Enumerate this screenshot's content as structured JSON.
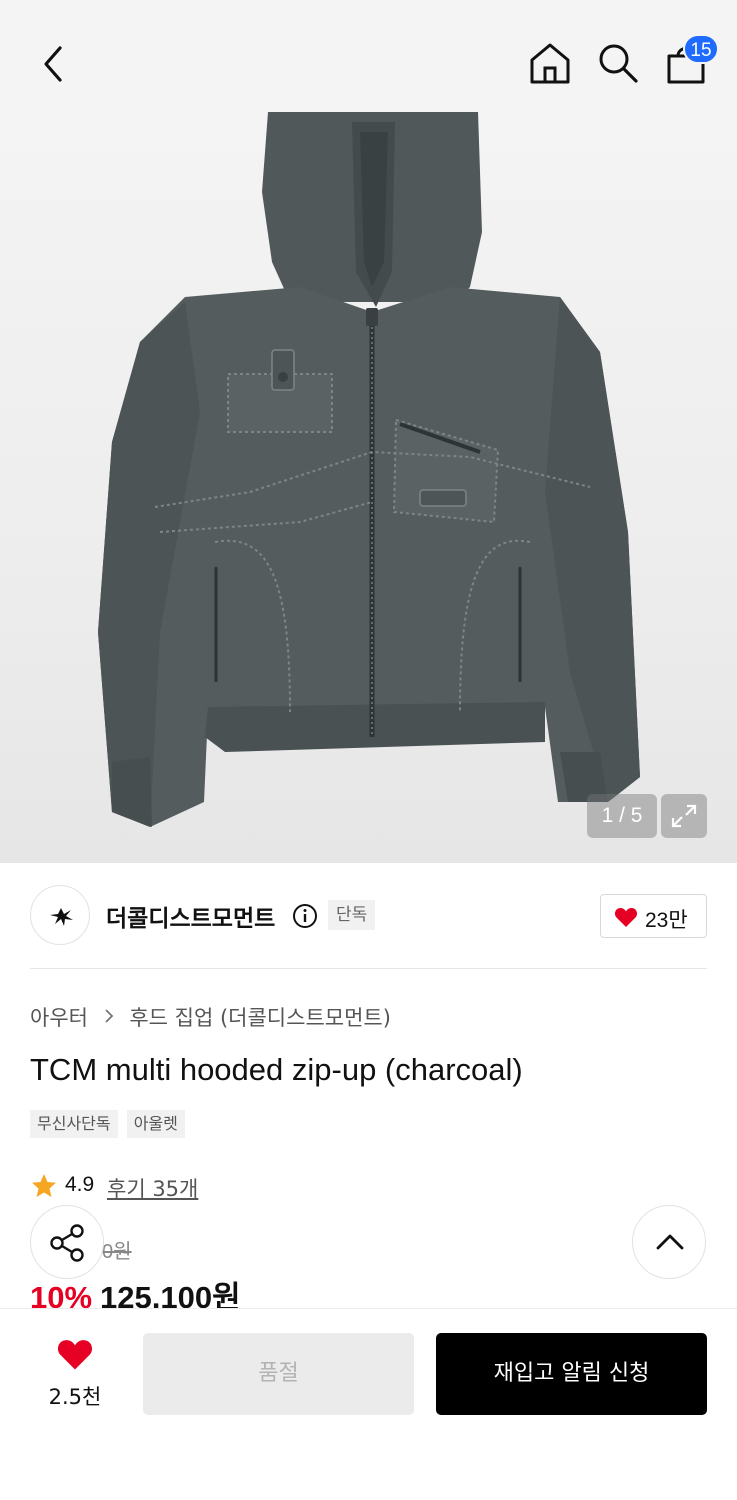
{
  "header": {
    "cart_count": "15"
  },
  "gallery": {
    "counter": "1 / 5"
  },
  "brand": {
    "name": "더콜디스트모먼트",
    "exclusive_tag": "단독",
    "likes": "23만"
  },
  "product": {
    "breadcrumb": [
      "아우터",
      "후드 집업 (더콜디스트모먼트)"
    ],
    "title": "TCM multi hooded zip-up (charcoal)",
    "tags": [
      "무신사단독",
      "아울렛"
    ],
    "rating": "4.9",
    "review_link": "후기 35개",
    "original_price_partial": "0원",
    "discount": "10%",
    "sale_price": "125,100원"
  },
  "bottom_bar": {
    "wish_count": "2.5천",
    "soldout_label": "품절",
    "restock_label": "재입고 알림 신청"
  },
  "colors": {
    "accent_blue": "#1f6bff",
    "discount_red": "#e60023",
    "heart_red": "#e60023",
    "star_orange": "#f5a623"
  }
}
